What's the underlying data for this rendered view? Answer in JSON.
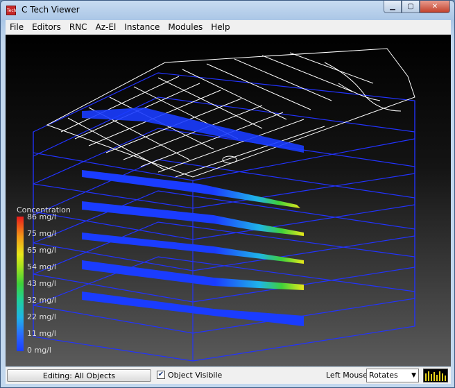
{
  "window": {
    "title": "C Tech Viewer",
    "app_icon": "ctech-icon"
  },
  "menu": {
    "items": [
      "File",
      "Editors",
      "RNC",
      "Az-El",
      "Instance",
      "Modules",
      "Help"
    ]
  },
  "legend": {
    "title": "Concentration",
    "ticks": [
      "86 mg/l",
      "75 mg/l",
      "65 mg/l",
      "54 mg/l",
      "43 mg/l",
      "32 mg/l",
      "22 mg/l",
      "11 mg/l",
      "0 mg/l"
    ]
  },
  "statusbar": {
    "edit_button": "Editing: All Objects",
    "object_visible_label": "Object Visibile",
    "object_visible_checked": true,
    "left_mouse_label": "Left Mouse",
    "left_mouse_mode": "Rotates"
  },
  "colors": {
    "outline": "#2233ff",
    "plume_low": "#1a3cff",
    "plume_high": "#e8e81a",
    "streets": "#ffffff"
  }
}
